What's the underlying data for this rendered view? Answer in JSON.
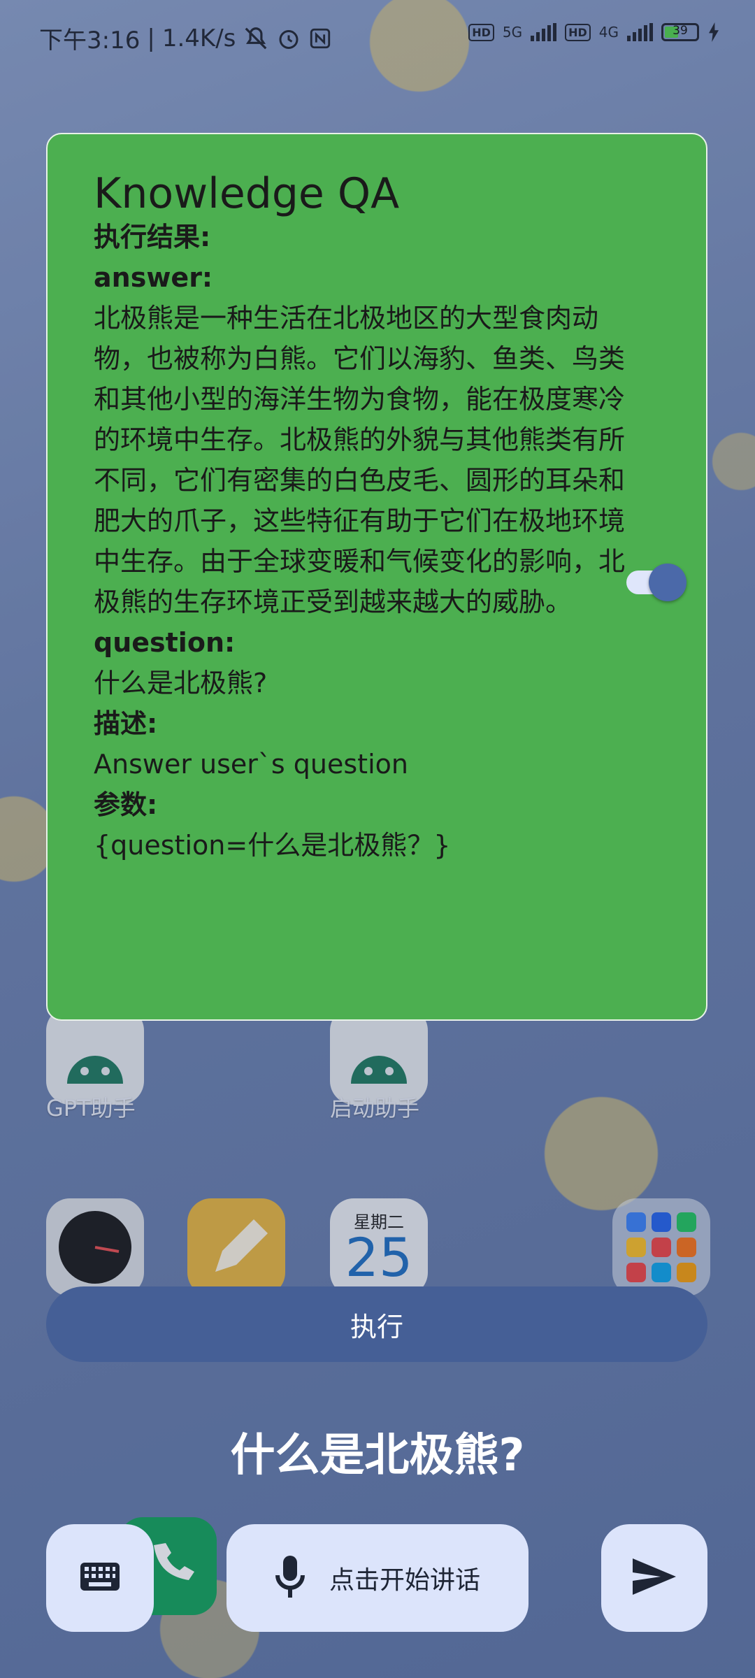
{
  "status_bar": {
    "time": "下午3:16",
    "speed": "1.4K/s",
    "net_5g": "5G",
    "net_4g": "4G",
    "hd": "HD",
    "battery": "39"
  },
  "home_screen": {
    "apps": [
      {
        "label": "GPT助手"
      },
      {
        "label": "启动助手"
      }
    ],
    "calendar_day": "星期二",
    "calendar_date": "25"
  },
  "card": {
    "title": "Knowledge QA",
    "result_label": "执行结果:",
    "answer_key": "answer:",
    "answer_value": "北极熊是一种生活在北极地区的大型食肉动物，也被称为白熊。它们以海豹、鱼类、鸟类和其他小型的海洋生物为食物，能在极度寒冷的环境中生存。北极熊的外貌与其他熊类有所不同，它们有密集的白色皮毛、圆形的耳朵和肥大的爪子，这些特征有助于它们在极地环境中生存。由于全球变暖和气候变化的影响，北极熊的生存环境正受到越来越大的威胁。",
    "question_key": "question:",
    "question_value": "什么是北极熊?",
    "description_key": "描述:",
    "description_value": "Answer user`s question",
    "params_key": "参数:",
    "params_value": "{question=什么是北极熊？}",
    "toggle_on": true
  },
  "execute_button": "执行",
  "query_text": "什么是北极熊?",
  "bottom_bar": {
    "keyboard_icon": "keyboard-icon",
    "mic_icon": "mic-icon",
    "mic_label": "点击开始讲话",
    "send_icon": "send-icon"
  },
  "colors": {
    "card_bg": "#4caf50",
    "accent": "#455f96",
    "bottom_button_bg": "#dce4fb"
  }
}
